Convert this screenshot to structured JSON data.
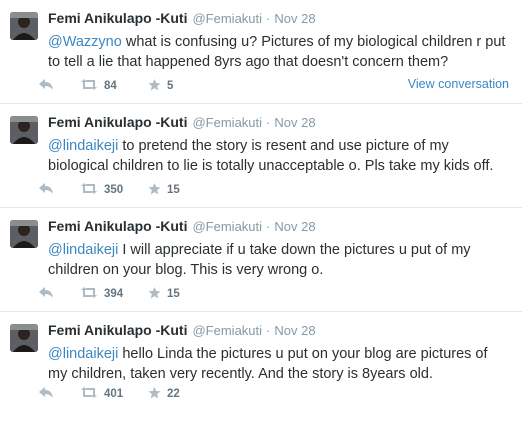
{
  "tweets": [
    {
      "fullname": "Femi Anikulapo -Kuti",
      "username": "@Femiakuti",
      "separator": "·",
      "time": "Nov 28",
      "mention": "@Wazzyno",
      "text": " what is confusing u? Pictures of my biological children r put to tell a lie that happened 8yrs ago that doesn't concern them?",
      "retweets": "84",
      "favorites": "5",
      "view_conversation": "View conversation"
    },
    {
      "fullname": "Femi Anikulapo -Kuti",
      "username": "@Femiakuti",
      "separator": "·",
      "time": "Nov 28",
      "mention": "@lindaikeji",
      "text": " to pretend the story is resent and use picture of my biological children to lie is totally unacceptable o. Pls take my kids off.",
      "retweets": "350",
      "favorites": "15"
    },
    {
      "fullname": "Femi Anikulapo -Kuti",
      "username": "@Femiakuti",
      "separator": "·",
      "time": "Nov 28",
      "mention": "@lindaikeji",
      "text": " I will appreciate if u take down the pictures u put of my children on your blog. This is very wrong o.",
      "retweets": "394",
      "favorites": "15"
    },
    {
      "fullname": "Femi Anikulapo -Kuti",
      "username": "@Femiakuti",
      "separator": "·",
      "time": "Nov 28",
      "mention": "@lindaikeji",
      "text": " hello Linda the pictures u put on your blog are pictures of my children, taken very recently. And the story is 8years old.",
      "retweets": "401",
      "favorites": "22"
    }
  ],
  "icons": {
    "reply": "reply-icon",
    "retweet": "retweet-icon",
    "favorite": "star-icon",
    "avatar": "avatar"
  },
  "colors": {
    "link": "#3b88c3",
    "muted": "#8899a6",
    "text": "#292f33",
    "divider": "#e1e8ed"
  }
}
